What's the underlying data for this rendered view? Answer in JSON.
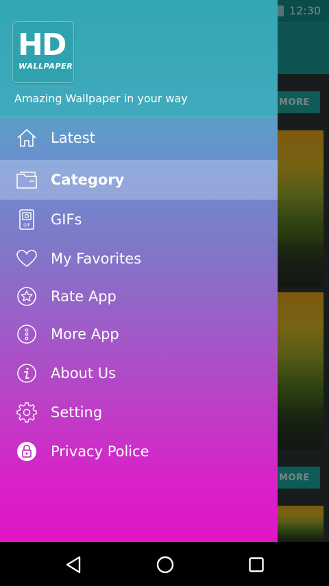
{
  "status_bar": {
    "time": "12:30"
  },
  "background_app": {
    "more_label": "MORE"
  },
  "drawer": {
    "logo": {
      "big": "HD",
      "small": "WALLPAPER"
    },
    "tagline": "Amazing Wallpaper in your way",
    "items": [
      {
        "label": "Latest",
        "icon": "home-icon"
      },
      {
        "label": "Category",
        "icon": "folder-icon",
        "active": true
      },
      {
        "label": "GIFs",
        "icon": "gif-file-icon"
      },
      {
        "label": "My Favorites",
        "icon": "heart-icon"
      },
      {
        "label": "Rate App",
        "icon": "star-circle-icon"
      },
      {
        "label": "More App",
        "icon": "more-dots-icon"
      },
      {
        "label": "About Us",
        "icon": "info-icon"
      },
      {
        "label": "Setting",
        "icon": "gear-icon"
      },
      {
        "label": "Privacy Police",
        "icon": "lock-icon"
      }
    ]
  },
  "nav_bar": {
    "buttons": [
      "back-icon",
      "home-circle-icon",
      "recents-icon"
    ]
  }
}
